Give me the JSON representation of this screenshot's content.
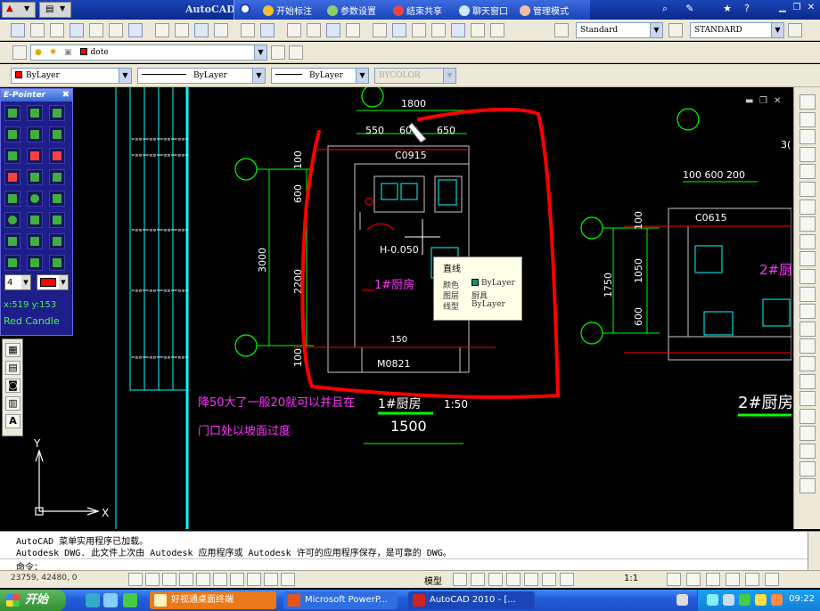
{
  "titlebar": {
    "app_name": "AutoCAD",
    "conference": {
      "items": [
        {
          "label": "开始标注",
          "icon": "annotate-icon"
        },
        {
          "label": "参数设置",
          "icon": "settings-icon"
        },
        {
          "label": "结束共享",
          "icon": "stop-share-icon"
        },
        {
          "label": "聊天窗口",
          "icon": "chat-icon"
        },
        {
          "label": "管理模式",
          "icon": "admin-icon"
        }
      ]
    }
  },
  "toolbar": {
    "layer_name": "dote",
    "text_style": "Standard",
    "dim_style": "STANDARD",
    "color": "ByLayer",
    "linetype": "ByLayer",
    "lineweight": "ByLayer",
    "plotstyle": "BYCOLOR"
  },
  "epointer": {
    "title": "E-Pointer",
    "line_width": "4",
    "pen_color": "#ff0000",
    "coords": "x:519  y:153",
    "brand": "Red Candle"
  },
  "drawing": {
    "dims": {
      "total": "1800",
      "d1": "550",
      "d2": "600",
      "d3": "650",
      "v1": "100",
      "v2": "600",
      "v3": "3000",
      "v4": "2200",
      "v5": "100",
      "r1": "100 600 200",
      "r2": "1750",
      "r3": "1050",
      "r4": "600",
      "r5": "100",
      "edge": "3("
    },
    "window_tag": "C0915",
    "window_tag_2": "C0615",
    "door_tag": "M0821",
    "elevation": "H-0.050",
    "room_1": "1#厨房",
    "room_2": "2#厨",
    "room_3": "2#厨房",
    "title_1": "1#厨房",
    "scale_1": "1:50",
    "dim_bottom": "1500",
    "dim_150": "150",
    "note_1": "降50大了一般20就可以并且在",
    "note_2": "门口处以坡面过度",
    "axis_y": "Y",
    "axis_x": "X"
  },
  "tooltip": {
    "title": "直线",
    "rows": [
      {
        "label": "颜色",
        "value": "ByLayer"
      },
      {
        "label": "图层",
        "value": "厨具"
      },
      {
        "label": "线型",
        "value": "ByLayer"
      }
    ]
  },
  "command_line": {
    "line_1": "AutoCAD 菜单实用程序已加载。",
    "line_2": "Autodesk DWG.   此文件上次由 Autodesk 应用程序或 Autodesk 许可的应用程序保存，是可靠的 DWG。",
    "prompt": "命令："
  },
  "status": {
    "coords": "23759, 42480, 0",
    "model_label": "模型",
    "annotation_scale": "1:1"
  },
  "taskbar": {
    "start_label": "开始",
    "tasks": [
      {
        "label": "好视通桌面终端"
      },
      {
        "label": "Microsoft PowerP..."
      },
      {
        "label": "AutoCAD 2010 - [..."
      }
    ],
    "clock": "09:22"
  }
}
